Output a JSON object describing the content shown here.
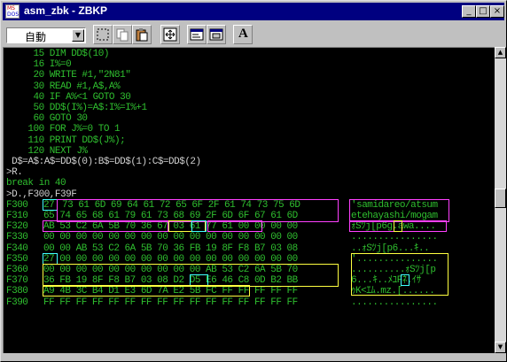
{
  "window": {
    "title": "asm_zbk - ZBKP",
    "icon_text": [
      "MS",
      "DOS"
    ],
    "buttons": {
      "minimize": "_",
      "maximize": "□",
      "close": "×"
    }
  },
  "toolbar": {
    "font_select_value": "自動",
    "buttons": [
      "mark-icon",
      "copy-icon",
      "paste-icon",
      "fullscreen-icon",
      "properties-icon",
      "background-icon",
      "font-icon"
    ],
    "font_button_label": "A"
  },
  "terminal": {
    "lines": [
      {
        "text": "     15 DIM DD$(10)",
        "color": "green"
      },
      {
        "text": "     16 I%=0",
        "color": "green"
      },
      {
        "text": "     20 WRITE #1,\"2N81\"",
        "color": "green"
      },
      {
        "text": "     30 READ #1,A$,A%",
        "color": "green"
      },
      {
        "text": "     40 IF A%<1 GOTO 30",
        "color": "green"
      },
      {
        "text": "     50 DD$(I%)=A$:I%=I%+1",
        "color": "green"
      },
      {
        "text": "     60 GOTO 30",
        "color": "green"
      },
      {
        "text": "    100 FOR J%=0 TO 1",
        "color": "green"
      },
      {
        "text": "    110 PRINT DD$(J%);",
        "color": "green"
      },
      {
        "text": "    120 NEXT J%",
        "color": "green"
      },
      {
        "text": " D$=A$:A$=DD$(0):B$=DD$(1):C$=DD$(2)",
        "color": "white"
      },
      {
        "text": ">R.",
        "color": "white"
      },
      {
        "text": "break in 40",
        "color": "green"
      },
      {
        "text": ">D.,F300,F39F",
        "color": "white"
      }
    ],
    "dump": [
      {
        "addr": "F300",
        "hex": "73 61 6D 69 64 61 72 65 6F 2F 61 74 73 75 6D",
        "first": "27",
        "ascii": "'samidareo/atsum"
      },
      {
        "addr": "F310",
        "hex": "65 74 65 68 61 79 61 73 68 69 2F 6D 6F 67 61 6D",
        "first": "",
        "ascii": "etehayashi/mogam"
      },
      {
        "addr": "F320",
        "hex": "AB 53 C2 6A 5B 70 36 67 03 61 77 61 00 00 00 00",
        "first": "",
        "ascii": "ｫSﾂj[p6g.awa...."
      },
      {
        "addr": "F330",
        "hex": "00 00 00 00 00 00 00 00 00 00 00 00 00 00 00 00",
        "first": "",
        "ascii": "................"
      },
      {
        "addr": "F340",
        "hex": "00 00 AB 53 C2 6A 5B 70 36 FB 19 8F F8 B7 03 08",
        "first": "",
        "ascii": "..ｫSﾂj[p6...ｷ.."
      },
      {
        "addr": "F350",
        "hex": "   00 00 00 00 00 00 00 00 00 00 00 00 00 00 00",
        "first": "27",
        "ascii": "'..............."
      },
      {
        "addr": "F360",
        "hex": "00 00 00 00 00 00 00 00 00 00 AB 53 C2 6A 5B 70",
        "first": "",
        "ascii": "..........ｫSﾂj[p"
      },
      {
        "addr": "F370",
        "hex": "36 FB 19 8F F8 B7 03 08 D2 D5 E6 46 C8 0D B2 BB",
        "first": "",
        "ascii": "6...ｷ..ﾒﾕFﾈ.ｲｻ"
      },
      {
        "addr": "F380",
        "hex": "A9 4B 3C B4 D1 E3 6D 7A E2 5B FC FF FF FF FF FF",
        "first": "",
        "ascii": "ｩK<ｴﾑ.mz.[......"
      },
      {
        "addr": "F390",
        "hex": "FF FF FF FF FF FF FF FF FF FF FF FF FF FF FF FF",
        "first": "",
        "ascii": "................"
      }
    ]
  },
  "colors": {
    "terminal_bg": "#000000",
    "text_green": "#2fbf2f",
    "highlight_magenta": "#ff40ff",
    "highlight_yellow": "#ffff40",
    "highlight_cyan": "#40ffff",
    "titlebar": "#000080"
  }
}
